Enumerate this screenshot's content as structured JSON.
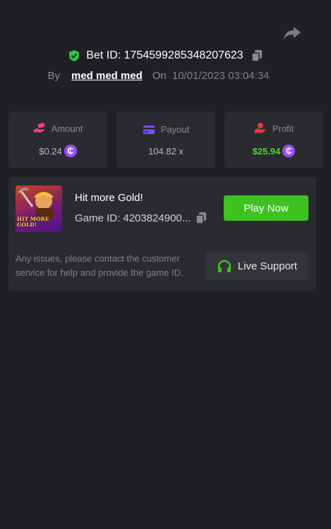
{
  "header": {
    "bet_id": "Bet ID: 1754599285348207623",
    "by_label": "By",
    "username": "med med med",
    "on_label": "On",
    "datetime": "10/01/2023 03:04:34"
  },
  "stats": {
    "amount": {
      "label": "Amount",
      "value": "$0.24"
    },
    "payout": {
      "label": "Payout",
      "value": "104.82 x"
    },
    "profit": {
      "label": "Profit",
      "value": "$25.94"
    }
  },
  "game": {
    "title": "Hit more Gold!",
    "game_id": "Game ID: 4203824900...",
    "thumb_text": "HIT MORE GOLD!",
    "play_label": "Play Now"
  },
  "support": {
    "help_text": "Any issues, please contact the customer service for help and provide the game ID.",
    "button_label": "Live Support"
  },
  "coin_symbol": "₵",
  "colors": {
    "background": "#1f2024",
    "card": "#2a2b30",
    "accent_green": "#3dc21f",
    "profit_green": "#44d62c",
    "coin_purple": "#9b4dff",
    "amount_icon": "#e8457a",
    "payout_icon": "#7c4dff",
    "profit_icon": "#e23a3a",
    "shield_green": "#2bc44a"
  },
  "icons": [
    "share-icon",
    "shield-check-icon",
    "copy-icon",
    "hand-money-icon",
    "card-icon",
    "hand-coin-icon",
    "coin-icon",
    "headset-icon"
  ]
}
